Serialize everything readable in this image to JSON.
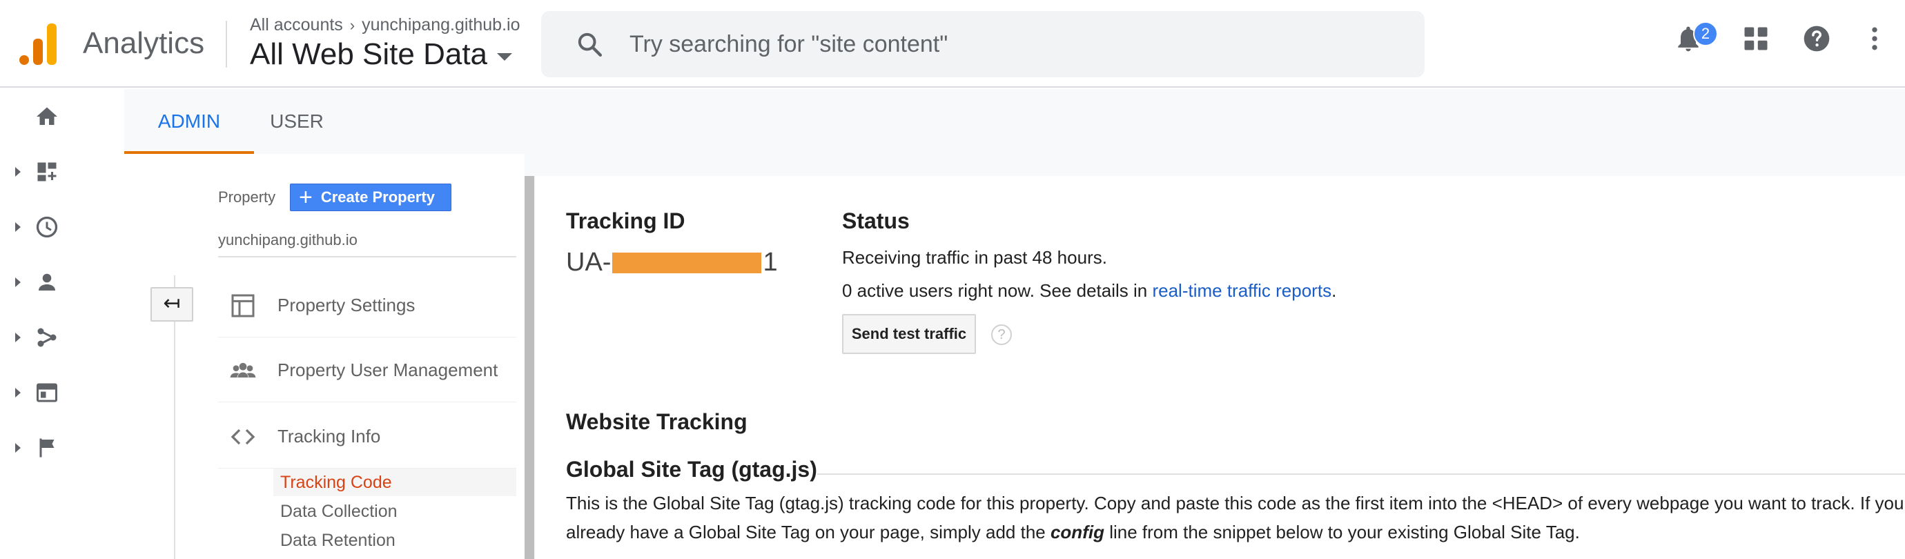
{
  "header": {
    "app_title": "Analytics",
    "breadcrumb_root": "All accounts",
    "breadcrumb_property": "yunchipang.github.io",
    "view_title": "All Web Site Data",
    "search_placeholder": "Try searching for \"site content\"",
    "notification_count": "2"
  },
  "tabs": {
    "admin": "ADMIN",
    "user": "USER"
  },
  "property": {
    "label": "Property",
    "create_button": "Create Property",
    "name": "yunchipang.github.io",
    "menu": [
      {
        "label": "Property Settings",
        "icon": "property-settings-icon"
      },
      {
        "label": "Property User Management",
        "icon": "users-icon"
      },
      {
        "label": "Tracking Info",
        "icon": "code-icon"
      }
    ],
    "submenu": [
      "Tracking Code",
      "Data Collection",
      "Data Retention"
    ],
    "active_submenu": "Tracking Code"
  },
  "tracking": {
    "heading": "Tracking ID",
    "id_prefix": "UA-",
    "id_suffix": "1"
  },
  "status": {
    "heading": "Status",
    "line1": "Receiving traffic in past 48 hours.",
    "line2_prefix": "0 active users right now. See details in ",
    "line2_link": "real-time traffic reports",
    "line2_suffix": ".",
    "send_button": "Send test traffic",
    "help_glyph": "?"
  },
  "website_tracking": {
    "heading": "Website Tracking",
    "gtag_heading": "Global Site Tag (gtag.js)",
    "desc_part1": "This is the Global Site Tag (gtag.js) tracking code for this property. Copy and paste this code as the first item into the <HEAD> of every webpage you want to track. If you already have a Global Site Tag on your page, simply add the ",
    "desc_bold": "config",
    "desc_part2": " line from the snippet below to your existing Global Site Tag."
  },
  "colors": {
    "accent_blue": "#1a73e8",
    "link_blue": "#1a5dc7",
    "active_orange": "#e37400",
    "redaction": "#f29a37"
  }
}
